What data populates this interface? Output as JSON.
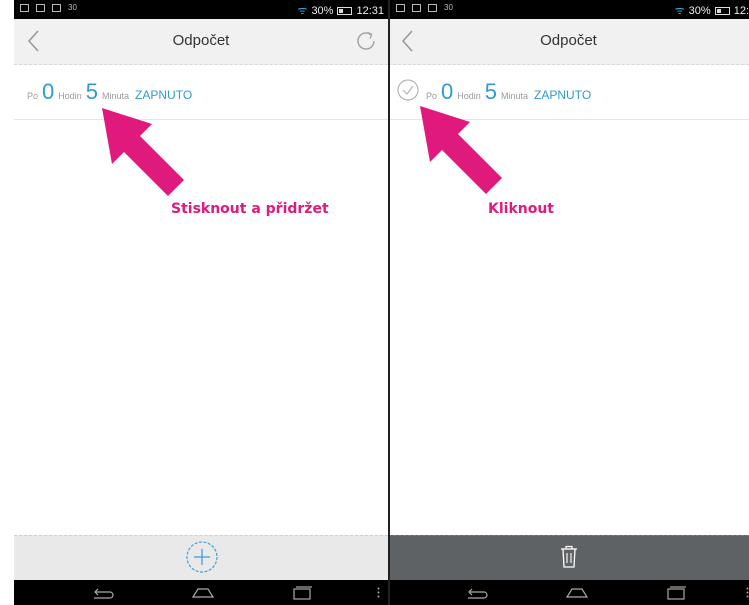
{
  "left_screen": {
    "status": {
      "icons": [
        "notification-icon",
        "image-icon",
        "mail-icon"
      ],
      "badge": "30",
      "battery": "30%",
      "time": "12:31"
    },
    "title": "Odpočet",
    "timer": {
      "prefix": "Po",
      "hours": "0",
      "hours_label": "Hodin",
      "minutes": "5",
      "minutes_label": "Minuta",
      "state": "ZAPNUTO"
    },
    "annotation": "Stisknout a přidržet"
  },
  "right_screen": {
    "status": {
      "icons": [
        "notification-icon",
        "image-icon",
        "mail-icon"
      ],
      "badge": "30",
      "battery": "30%",
      "time": "12:"
    },
    "title": "Odpočet",
    "timer": {
      "prefix": "Po",
      "hours": "0",
      "hours_label": "Hodin",
      "minutes": "5",
      "minutes_label": "Minuta",
      "state": "ZAPNUTO"
    },
    "annotation": "Kliknout"
  },
  "colors": {
    "accent": "#2f9bd0",
    "annotation": "#e0197d",
    "status_bar": "#000000",
    "toolbar_light": "#e9e9e9",
    "toolbar_dark": "#5f6264"
  }
}
